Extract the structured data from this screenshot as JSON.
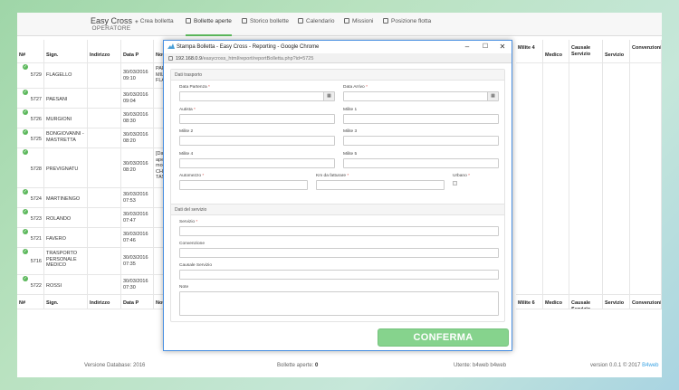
{
  "app": {
    "name": "Easy Cross",
    "subtitle": "OPERATORE"
  },
  "nav": [
    {
      "label": "Crea bolletta",
      "icon": "plus-icon"
    },
    {
      "label": "Bollette aperte",
      "icon": "document-icon"
    },
    {
      "label": "Storico bollette",
      "icon": "list-icon"
    },
    {
      "label": "Calendario",
      "icon": "calendar-icon"
    },
    {
      "label": "Missioni",
      "icon": "camera-icon"
    },
    {
      "label": "Posizione flotta",
      "icon": "map-icon"
    }
  ],
  "table": {
    "headers": [
      "N#",
      "Sign.",
      "Indirizzo",
      "Data P",
      "Not"
    ],
    "right_headers": [
      "Milite 4",
      "Medico",
      "Causale Servizio",
      "Servizio",
      "Convenzioni"
    ],
    "footer_headers": [
      "N#",
      "Sign.",
      "Indirizzo",
      "Data P",
      "Not"
    ],
    "footer_right_headers": [
      "Milite 6",
      "Medico",
      "Causale Servizio",
      "Servizio",
      "Convenzioni"
    ],
    "rows": [
      {
        "num": "5729",
        "sign": "FLAGELLO",
        "date": "30/03/2016 09:10",
        "note": "PAR MILI FLA"
      },
      {
        "num": "5727",
        "sign": "PAESANI",
        "date": "30/03/2016 09:04",
        "note": ""
      },
      {
        "num": "5726",
        "sign": "MURGIONI",
        "date": "30/03/2016 08:30",
        "note": ""
      },
      {
        "num": "5725",
        "sign": "BONGIOVANNI - MASTRETTA",
        "date": "30/03/2016 08:20",
        "note": ""
      },
      {
        "num": "5728",
        "sign": "PREVIGNATU",
        "date": "30/03/2016 08:20",
        "note": "[Dat ape mod CHE TAS"
      },
      {
        "num": "5724",
        "sign": "MARTINENGO",
        "date": "30/03/2016 07:53",
        "note": ""
      },
      {
        "num": "5723",
        "sign": "ROLANDO",
        "date": "30/03/2016 07:47",
        "note": ""
      },
      {
        "num": "5721",
        "sign": "FAVERO",
        "date": "30/03/2016 07:46",
        "note": ""
      },
      {
        "num": "5716",
        "sign": "TRASPORTO PERSONALE MEDICO",
        "date": "30/03/2016 07:35",
        "note": ""
      },
      {
        "num": "5722",
        "sign": "ROSSI",
        "date": "30/03/2016 07:30",
        "note": ""
      }
    ]
  },
  "footer": {
    "version_db": "Versione Database: 2016",
    "open_label": "Bollette aperte:",
    "open_count": "0",
    "user": "Utente: b4web b4web",
    "version_prefix": "version 0.0.1 © 2017",
    "version_link": "B4web"
  },
  "popup": {
    "title": "Stampa Bolletta - Easy Cross - Reporting - Google Chrome",
    "url_host": "192.168.0.9",
    "url_path": "/easycross_html/report/reportBolletta.php?id=5725",
    "section_transport": "Dati trasporto",
    "section_service": "Dati del servizio",
    "fields": {
      "data_partenza": "Data Partenza",
      "data_arrivo": "Data Arrivo",
      "autista": "Autista",
      "milite1": "Milite 1",
      "milite2": "Milite 2",
      "milite3": "Milite 3",
      "milite4": "Milite 4",
      "milite5": "Milite 5",
      "automezzo": "Automezzo",
      "km": "Km da fatturare",
      "urbano": "Urbano",
      "servizio": "Servizio",
      "convenzione": "Convenzione",
      "causale": "Causale Servizio",
      "note": "Note"
    },
    "req": "*",
    "calendar_glyph": "▦",
    "confirm": "CONFERMA"
  }
}
